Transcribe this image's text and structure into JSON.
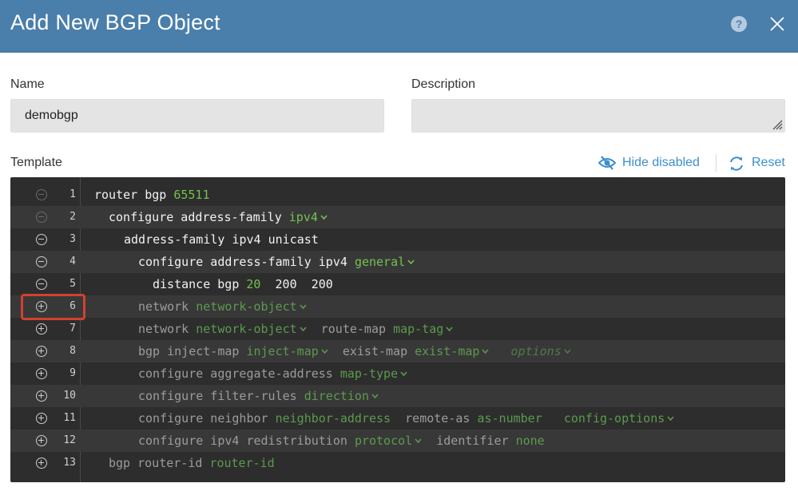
{
  "dialog": {
    "title": "Add New BGP Object",
    "help_glyph": "?",
    "colors": {
      "header": "#4a7eab",
      "link": "#3c8fcf",
      "editor_bg": "#2d2d2d",
      "highlight": "#d2412e",
      "keyword": "#74c24e"
    }
  },
  "form": {
    "name_label": "Name",
    "name_value": "demobgp",
    "description_label": "Description",
    "description_value": ""
  },
  "template": {
    "label": "Template",
    "hide_disabled_label": "Hide disabled",
    "reset_label": "Reset"
  },
  "editor": {
    "highlighted_line": 6,
    "lines": [
      {
        "n": "1",
        "toggle": "minus-faint",
        "t": [
          [
            "router bgp ",
            "white"
          ],
          [
            "65511",
            "green"
          ]
        ]
      },
      {
        "n": "2",
        "toggle": "minus-faint",
        "t": [
          [
            "configure address-family ",
            "white"
          ],
          [
            "ipv4",
            "green",
            "v"
          ]
        ]
      },
      {
        "n": "3",
        "toggle": "minus",
        "t": [
          [
            "address-family ipv4 unicast",
            "white"
          ]
        ]
      },
      {
        "n": "4",
        "toggle": "minus",
        "t": [
          [
            "configure address-family ipv4 ",
            "white"
          ],
          [
            "general",
            "green",
            "v"
          ]
        ]
      },
      {
        "n": "5",
        "toggle": "minus",
        "t": [
          [
            "distance bgp ",
            "white"
          ],
          [
            "20",
            "green"
          ],
          [
            "  ",
            "white"
          ],
          [
            "200",
            "white"
          ],
          [
            "  ",
            "white"
          ],
          [
            "200",
            "white"
          ]
        ]
      },
      {
        "n": "6",
        "toggle": "plus",
        "t": [
          [
            "network ",
            "grey"
          ],
          [
            "network-object",
            "dgreen",
            "v"
          ]
        ]
      },
      {
        "n": "7",
        "toggle": "plus",
        "t": [
          [
            "network ",
            "grey"
          ],
          [
            "network-object",
            "dgreen",
            "v"
          ],
          [
            " route-map ",
            "grey"
          ],
          [
            "map-tag",
            "dgreen",
            "v"
          ]
        ]
      },
      {
        "n": "8",
        "toggle": "plus",
        "t": [
          [
            "bgp inject-map ",
            "grey"
          ],
          [
            "inject-map",
            "dgreen",
            "v"
          ],
          [
            " exist-map ",
            "grey"
          ],
          [
            "exist-map",
            "dgreen",
            "v"
          ],
          [
            "  ",
            "grey"
          ],
          [
            "options",
            "ital",
            "v"
          ]
        ]
      },
      {
        "n": "9",
        "toggle": "plus",
        "t": [
          [
            "configure aggregate-address ",
            "grey"
          ],
          [
            "map-type",
            "dgreen",
            "v"
          ]
        ]
      },
      {
        "n": "10",
        "toggle": "plus",
        "t": [
          [
            "configure filter-rules ",
            "grey"
          ],
          [
            "direction",
            "dgreen",
            "v"
          ]
        ]
      },
      {
        "n": "11",
        "toggle": "plus",
        "t": [
          [
            "configure neighbor ",
            "grey"
          ],
          [
            "neighbor-address",
            "dgreen"
          ],
          [
            "  remote-as ",
            "grey"
          ],
          [
            "as-number",
            "dgreen"
          ],
          [
            "   ",
            "grey"
          ],
          [
            "config-options",
            "dgreen",
            "v"
          ]
        ]
      },
      {
        "n": "12",
        "toggle": "plus",
        "t": [
          [
            "configure ipv4 redistribution ",
            "grey"
          ],
          [
            "protocol",
            "dgreen",
            "v"
          ],
          [
            " identifier ",
            "grey"
          ],
          [
            "none",
            "dgreen"
          ]
        ]
      },
      {
        "n": "13",
        "toggle": "plus",
        "t": [
          [
            "bgp router-id ",
            "grey"
          ],
          [
            "router-id",
            "dgreen"
          ]
        ]
      }
    ]
  }
}
